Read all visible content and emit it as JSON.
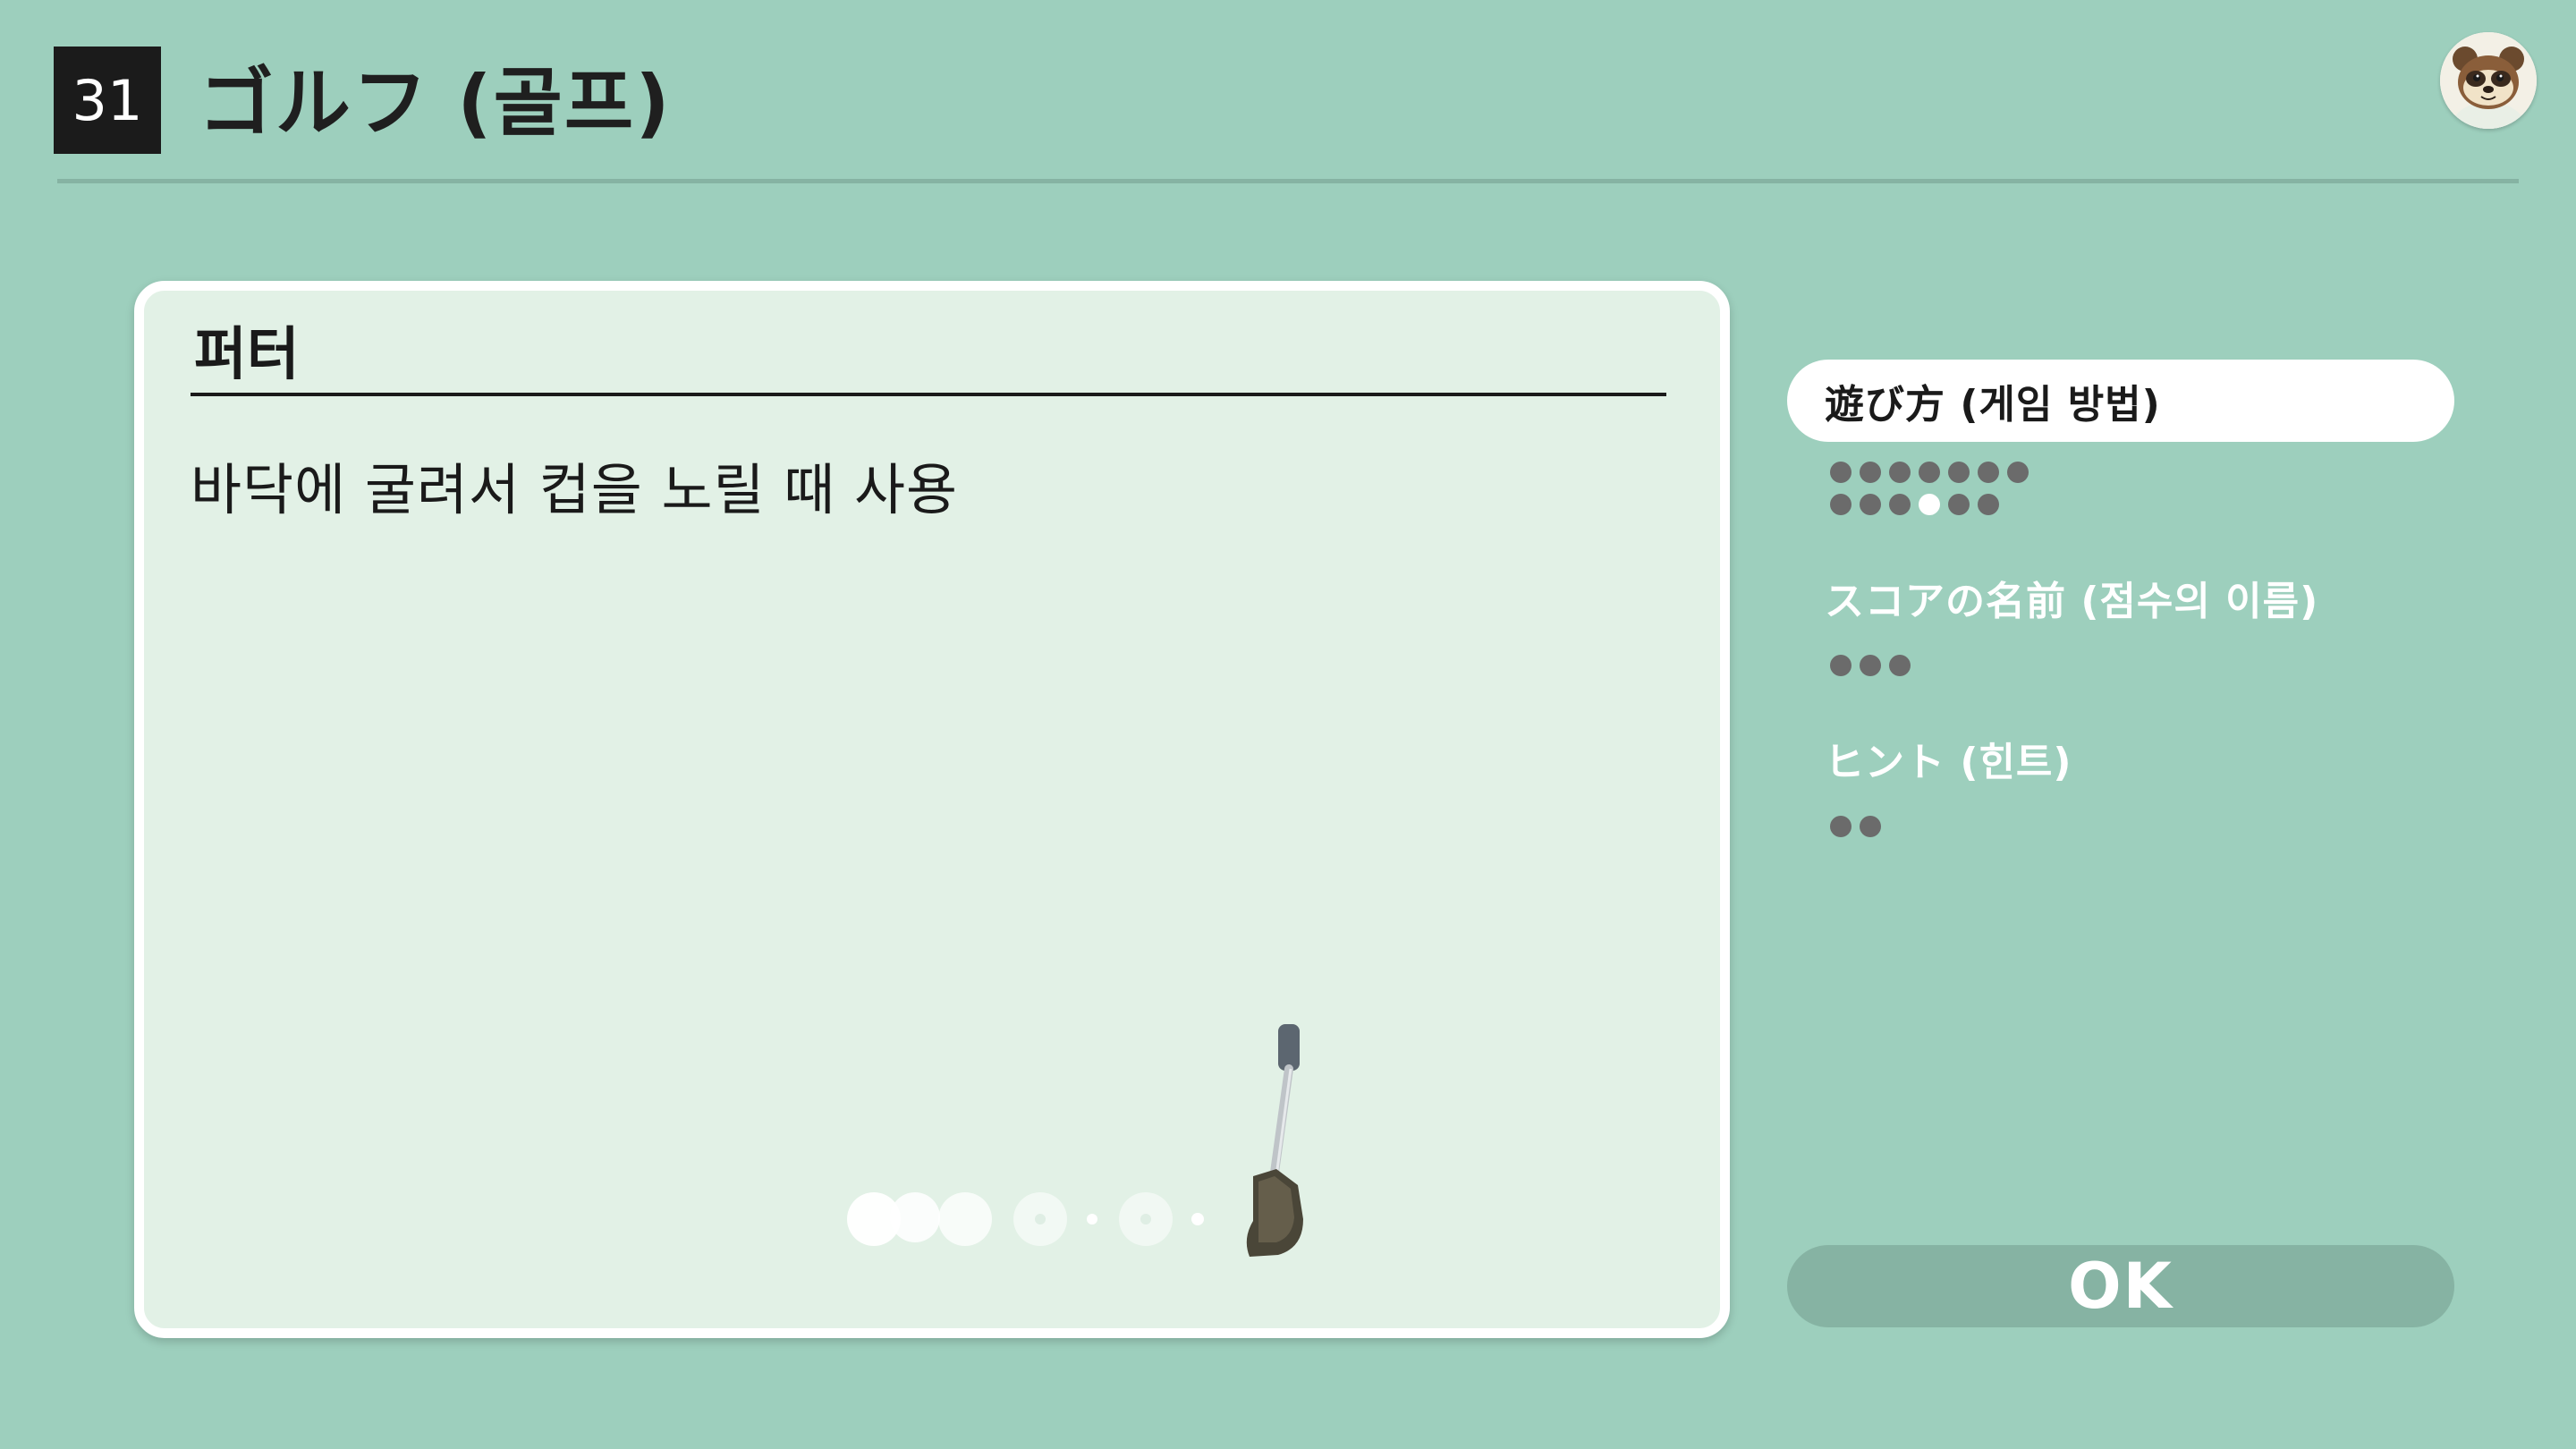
{
  "header": {
    "game_number": "31",
    "title": "ゴルフ (골프)"
  },
  "card": {
    "title": "퍼터",
    "description": "바닥에 굴려서 컵을 노릴 때 사용"
  },
  "menu": {
    "sections": [
      {
        "label": "遊び方 (게임 방법)",
        "active": true,
        "pages": 13,
        "current_page": 10
      },
      {
        "label": "スコアの名前 (점수의 이름)",
        "active": false,
        "pages": 3
      },
      {
        "label": "ヒント (힌트)",
        "active": false,
        "pages": 2
      }
    ]
  },
  "ok_button": {
    "label": "OK"
  },
  "colors": {
    "background": "#9dcfbd",
    "card": "#e2f1e6",
    "dot": "#6b6b6b",
    "ok_button": "#86b3a3"
  },
  "icons": {
    "avatar": "tom-nook-avatar-icon",
    "club": "putter-club-icon",
    "ball": "golf-ball-icon"
  }
}
